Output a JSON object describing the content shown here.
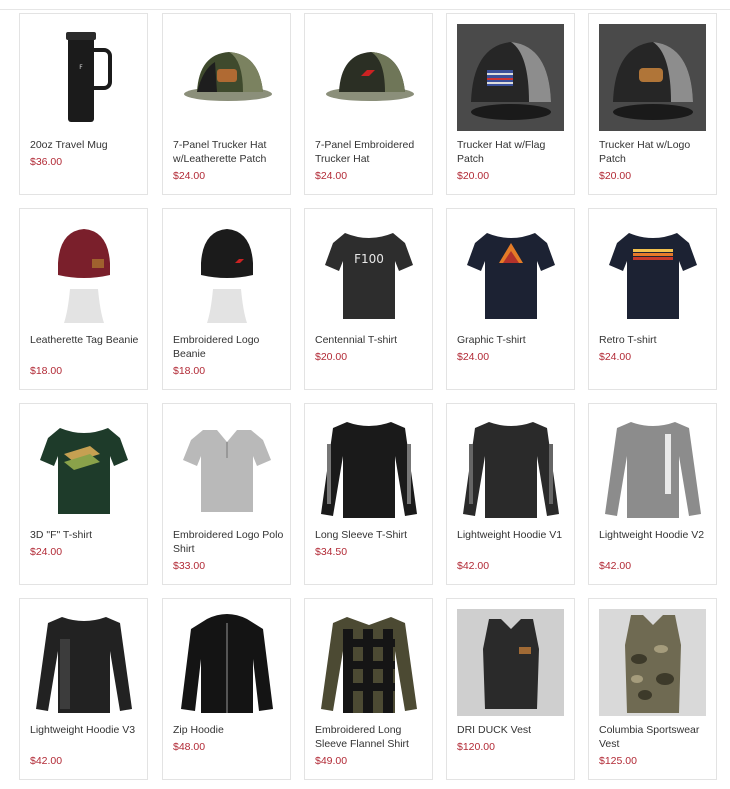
{
  "products": [
    {
      "name": "20oz Travel Mug",
      "price": "$36.00",
      "icon": "travel-mug-icon"
    },
    {
      "name": "7-Panel Trucker Hat w/Leatherette Patch",
      "price": "$24.00",
      "icon": "trucker-hat-icon"
    },
    {
      "name": "7-Panel Embroidered Trucker Hat",
      "price": "$24.00",
      "icon": "trucker-hat-icon"
    },
    {
      "name": "Trucker Hat w/Flag Patch",
      "price": "$20.00",
      "icon": "flag-hat-icon"
    },
    {
      "name": "Trucker Hat w/Logo Patch",
      "price": "$20.00",
      "icon": "logo-hat-icon"
    },
    {
      "name": "Leatherette Tag Beanie",
      "price": "$18.00",
      "icon": "beanie-icon"
    },
    {
      "name": "Embroidered Logo Beanie",
      "price": "$18.00",
      "icon": "beanie-icon"
    },
    {
      "name": "Centennial T-shirt",
      "price": "$20.00",
      "icon": "tshirt-icon"
    },
    {
      "name": "Graphic T-shirt",
      "price": "$24.00",
      "icon": "tshirt-icon"
    },
    {
      "name": "Retro T-shirt",
      "price": "$24.00",
      "icon": "tshirt-icon"
    },
    {
      "name": "3D \"F\" T-shirt",
      "price": "$24.00",
      "icon": "tshirt-icon"
    },
    {
      "name": "Embroidered Logo Polo Shirt",
      "price": "$33.00",
      "icon": "polo-icon"
    },
    {
      "name": "Long Sleeve T-Shirt",
      "price": "$34.50",
      "icon": "long-sleeve-icon"
    },
    {
      "name": "Lightweight Hoodie V1",
      "price": "$42.00",
      "icon": "long-sleeve-icon"
    },
    {
      "name": "Lightweight Hoodie V2",
      "price": "$42.00",
      "icon": "long-sleeve-icon"
    },
    {
      "name": "Lightweight Hoodie V3",
      "price": "$42.00",
      "icon": "long-sleeve-icon"
    },
    {
      "name": "Zip Hoodie",
      "price": "$48.00",
      "icon": "hoodie-icon"
    },
    {
      "name": "Embroidered Long Sleeve Flannel Shirt",
      "price": "$49.00",
      "icon": "flannel-icon"
    },
    {
      "name": "DRI DUCK Vest",
      "price": "$120.00",
      "icon": "vest-icon"
    },
    {
      "name": "Columbia Sportswear Vest",
      "price": "$125.00",
      "icon": "vest-icon"
    }
  ],
  "colors": {
    "price": "#b22a36",
    "border": "#e3e3e3",
    "text": "#333333"
  }
}
